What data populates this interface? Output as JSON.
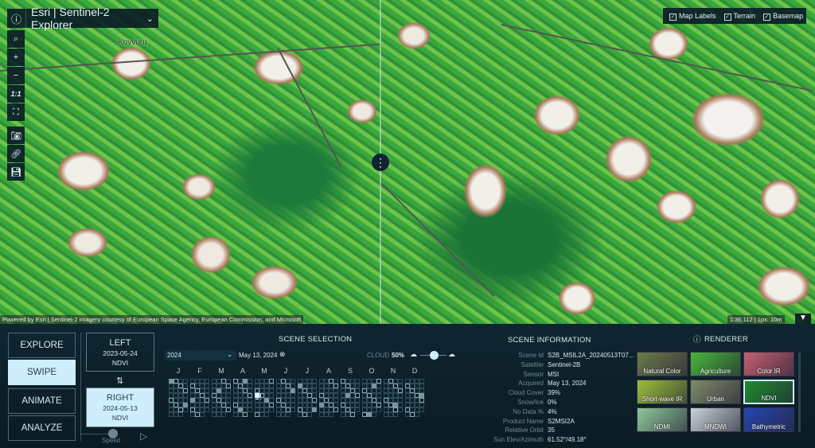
{
  "app": {
    "title": "Esri | Sentinel-2 Explorer"
  },
  "map": {
    "place_label": "Kovvuru",
    "attribution": "Powered by Esri | Sentinel-2 imagery courtesy of European Space Agency, European Commission, and Microsoft",
    "scale": "1:36,112 | 1px: 10m",
    "layers": [
      {
        "label": "Map Labels",
        "checked": true
      },
      {
        "label": "Terrain",
        "checked": true
      },
      {
        "label": "Basemap",
        "checked": true
      }
    ],
    "tools": {
      "zoom_one": "1:1"
    }
  },
  "modes": [
    "EXPLORE",
    "SWIPE",
    "ANIMATE",
    "ANALYZE"
  ],
  "active_mode": "SWIPE",
  "swipe": {
    "left": {
      "label": "LEFT",
      "date": "2023-05-24",
      "renderer": "NDVI"
    },
    "right": {
      "label": "RIGHT",
      "date": "2024-05-13",
      "renderer": "NDVI"
    },
    "swap_icon": "⇅",
    "speed_label": "Speed"
  },
  "scene_selection": {
    "title": "SCENE SELECTION",
    "year": "2024",
    "selected_date": "May 13, 2024",
    "cloud_label": "CLOUD",
    "cloud_value": "50%",
    "cloud_fraction": 0.5,
    "months": [
      "J",
      "F",
      "M",
      "A",
      "M",
      "J",
      "J",
      "A",
      "S",
      "O",
      "N",
      "D"
    ]
  },
  "scene_info": {
    "title": "SCENE INFORMATION",
    "rows": [
      {
        "label": "Scene Id",
        "value": "S2B_MSIL2A_20240513T07..."
      },
      {
        "label": "Satellite",
        "value": "Sentinel-2B"
      },
      {
        "label": "Sensor",
        "value": "MSI"
      },
      {
        "label": "Acquired",
        "value": "May 13, 2024"
      },
      {
        "label": "Cloud Cover",
        "value": "39%"
      },
      {
        "label": "Snow/Ice",
        "value": "0%"
      },
      {
        "label": "No Data %",
        "value": "4%"
      },
      {
        "label": "Product Name",
        "value": "S2MSI2A"
      },
      {
        "label": "Relative Orbit",
        "value": "35"
      },
      {
        "label": "Sun Elev/Azimuth",
        "value": "61.52°/49.18°"
      }
    ]
  },
  "renderer": {
    "title": "RENDERER",
    "items": [
      {
        "label": "Natural Color",
        "color": "#6b7a4a"
      },
      {
        "label": "Agriculture",
        "color": "#49b53a"
      },
      {
        "label": "Color IR",
        "color": "#c46070"
      },
      {
        "label": "Short-wave IR",
        "color": "#9bbf3a"
      },
      {
        "label": "Urban",
        "color": "#7f8a6a"
      },
      {
        "label": "NDVI",
        "color": "#1f8a2f"
      },
      {
        "label": "NDMI",
        "color": "#8fc79a"
      },
      {
        "label": "MNDWI",
        "color": "#c9d2d8"
      },
      {
        "label": "Bathymetric",
        "color": "#2546b0"
      }
    ],
    "active": "NDVI"
  }
}
